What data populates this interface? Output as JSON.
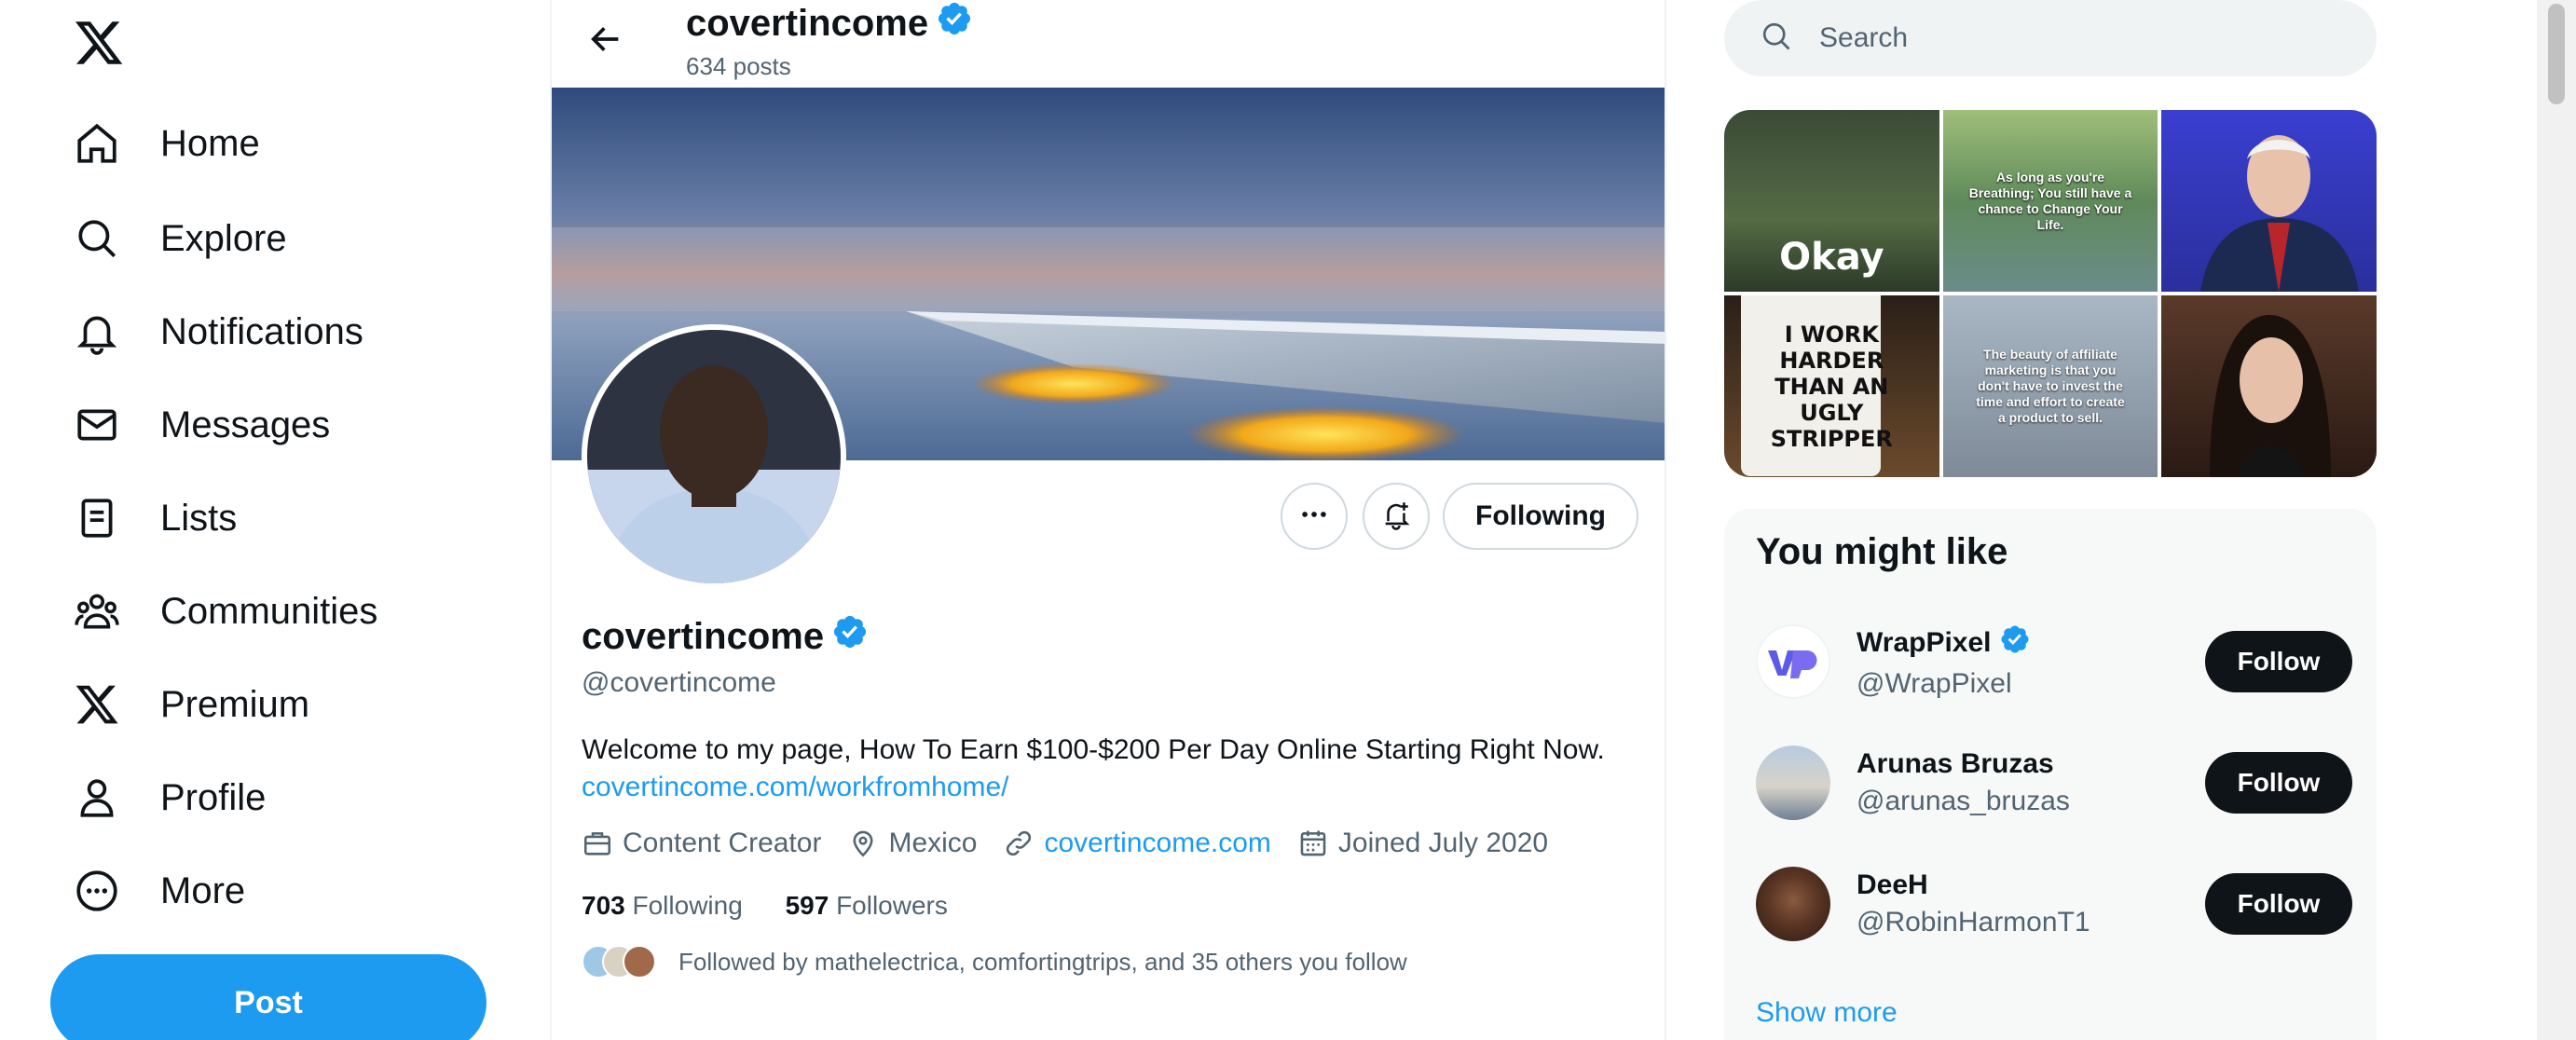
{
  "nav": {
    "items": [
      {
        "label": "Home",
        "icon": "home-icon"
      },
      {
        "label": "Explore",
        "icon": "search-icon"
      },
      {
        "label": "Notifications",
        "icon": "bell-icon"
      },
      {
        "label": "Messages",
        "icon": "envelope-icon"
      },
      {
        "label": "Lists",
        "icon": "list-icon"
      },
      {
        "label": "Communities",
        "icon": "people-icon"
      },
      {
        "label": "Premium",
        "icon": "x-logo-icon"
      },
      {
        "label": "Profile",
        "icon": "person-icon"
      },
      {
        "label": "More",
        "icon": "more-circle-icon"
      }
    ],
    "post_label": "Post"
  },
  "header": {
    "name": "covertincome",
    "posts": "634 posts"
  },
  "profile": {
    "name": "covertincome",
    "handle": "@covertincome",
    "bio": "Welcome to my page, How To Earn $100-$200 Per Day Online Starting Right Now.",
    "bio_link": "covertincome.com/workfromhome/",
    "category": "Content Creator",
    "location": "Mexico",
    "website": "covertincome.com",
    "joined": "Joined July 2020",
    "following_count": "703",
    "following_label": "Following",
    "followers_count": "597",
    "followers_label": "Followers",
    "followed_by": "Followed by mathelectrica, comfortingtrips, and 35 others you follow",
    "following_button": "Following"
  },
  "search": {
    "placeholder": "Search"
  },
  "media": {
    "tiles": [
      {
        "text": "Okay"
      },
      {
        "text": "As long as you're Breathing; You still have a chance to Change Your Life."
      },
      {
        "text": ""
      },
      {
        "text": "I WORK HARDER THAN AN UGLY STRIPPER"
      },
      {
        "text": "The beauty of affiliate marketing is that you don't have to invest the time and effort to create a product to sell."
      },
      {
        "text": ""
      }
    ]
  },
  "suggestions": {
    "title": "You might like",
    "users": [
      {
        "name": "WrapPixel",
        "handle": "@WrapPixel",
        "verified": true,
        "button": "Follow"
      },
      {
        "name": "Arunas Bruzas",
        "handle": "@arunas_bruzas",
        "verified": false,
        "button": "Follow"
      },
      {
        "name": "DeeH",
        "handle": "@RobinHarmonT1",
        "verified": false,
        "button": "Follow"
      }
    ],
    "show_more": "Show more"
  },
  "colors": {
    "accent": "#1d9bf0",
    "text": "#0f1419",
    "secondary": "#536471"
  }
}
